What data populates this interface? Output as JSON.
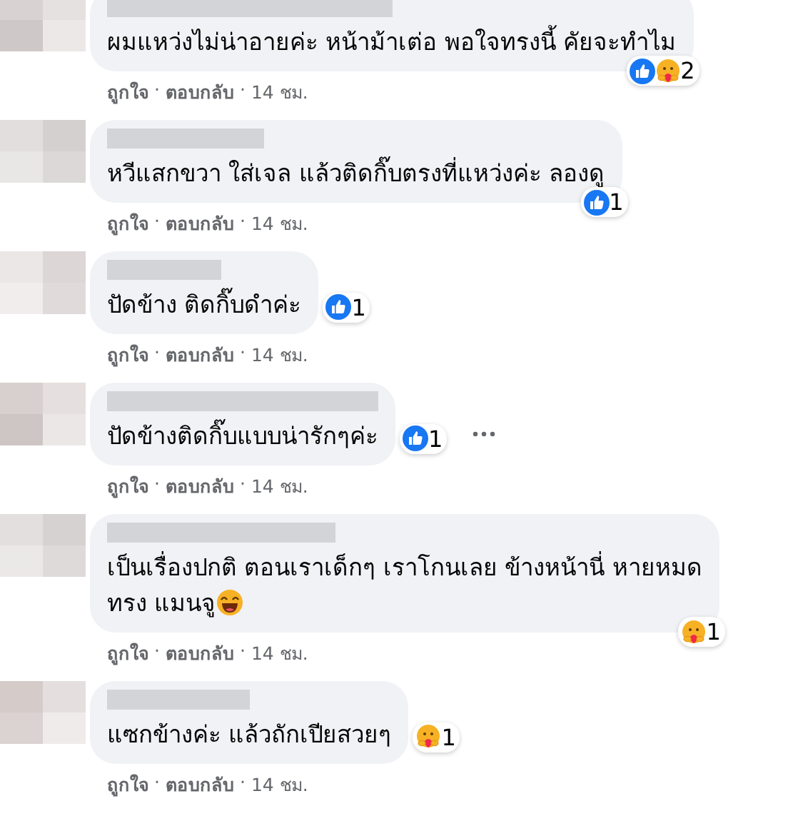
{
  "comments": [
    {
      "lines": [
        "ผมแหว่งไม่น่าอายค่ะ หน้าม้าเต่อ พอใจทรงนี้ คัยจะทำไม"
      ],
      "reaction_badge": {
        "kind": "corner",
        "icons": [
          {
            "kind": "like"
          },
          {
            "kind": "care"
          }
        ],
        "count": "2"
      },
      "more_menu": false,
      "actions": [
        {
          "kind": "link",
          "text": "ถูกใจ"
        },
        {
          "kind": "separator",
          "text": "·"
        },
        {
          "kind": "link",
          "text": "ตอบกลับ"
        },
        {
          "kind": "separator",
          "text": "·"
        },
        {
          "kind": "time",
          "text": "14 ชม."
        }
      ]
    },
    {
      "lines": [
        "หวีแสกขวา ใส่เจล แล้วติดกิ๊บตรงที่แหว่งค่ะ ลองดู"
      ],
      "reaction_badge": {
        "kind": "corner",
        "icons": [
          {
            "kind": "like"
          }
        ],
        "count": "1"
      },
      "more_menu": false,
      "actions": [
        {
          "kind": "link",
          "text": "ถูกใจ"
        },
        {
          "kind": "separator",
          "text": "·"
        },
        {
          "kind": "link",
          "text": "ตอบกลับ"
        },
        {
          "kind": "separator",
          "text": "·"
        },
        {
          "kind": "time",
          "text": "14 ชม."
        }
      ]
    },
    {
      "lines": [
        "ปัดข้าง ติดกิ๊บดำค่ะ"
      ],
      "reaction_badge": {
        "kind": "inline",
        "icons": [
          {
            "kind": "like"
          }
        ],
        "count": "1"
      },
      "more_menu": false,
      "actions": [
        {
          "kind": "link",
          "text": "ถูกใจ"
        },
        {
          "kind": "separator",
          "text": "·"
        },
        {
          "kind": "link",
          "text": "ตอบกลับ"
        },
        {
          "kind": "separator",
          "text": "·"
        },
        {
          "kind": "time",
          "text": "14 ชม."
        }
      ]
    },
    {
      "lines": [
        "ปัดข้างติดกิ๊บแบบน่ารักๆค่ะ"
      ],
      "reaction_badge": {
        "kind": "inline",
        "icons": [
          {
            "kind": "like"
          }
        ],
        "count": "1"
      },
      "more_menu": true,
      "actions": [
        {
          "kind": "link",
          "text": "ถูกใจ"
        },
        {
          "kind": "separator",
          "text": "·"
        },
        {
          "kind": "link",
          "text": "ตอบกลับ"
        },
        {
          "kind": "separator",
          "text": "·"
        },
        {
          "kind": "time",
          "text": "14 ชม."
        }
      ]
    },
    {
      "lines": [
        "เป็นเรื่องปกติ ตอนเราเด็กๆ เราโกนเลย ข้างหน้านี่ หายหมด",
        "ทรง แมนจู"
      ],
      "emoji": {
        "kind": "laugh"
      },
      "reaction_badge": {
        "kind": "corner",
        "icons": [
          {
            "kind": "care"
          }
        ],
        "count": "1"
      },
      "more_menu": false,
      "actions": [
        {
          "kind": "link",
          "text": "ถูกใจ"
        },
        {
          "kind": "separator",
          "text": "·"
        },
        {
          "kind": "link",
          "text": "ตอบกลับ"
        },
        {
          "kind": "separator",
          "text": "·"
        },
        {
          "kind": "time",
          "text": "14 ชม."
        }
      ]
    },
    {
      "lines": [
        "แซกข้างค่ะ แล้วถักเปียสวยๆ"
      ],
      "reaction_badge": {
        "kind": "inline",
        "icons": [
          {
            "kind": "care"
          }
        ],
        "count": "1"
      },
      "more_menu": false,
      "actions": [
        {
          "kind": "link",
          "text": "ถูกใจ"
        },
        {
          "kind": "separator",
          "text": "·"
        },
        {
          "kind": "link",
          "text": "ตอบกลับ"
        },
        {
          "kind": "separator",
          "text": "·"
        },
        {
          "kind": "time",
          "text": "14 ชม."
        }
      ]
    }
  ]
}
